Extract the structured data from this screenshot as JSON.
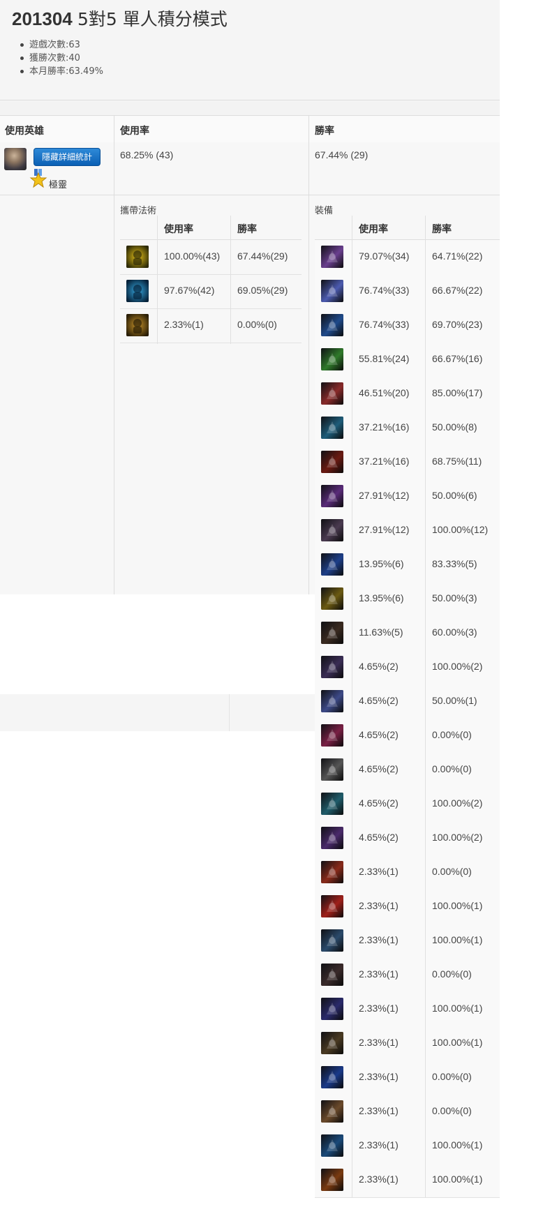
{
  "page": {
    "title_number": "201304",
    "title_mode": "5對5 單人積分模式",
    "stats": [
      "遊戲次數:63",
      "獲勝次數:40",
      "本月勝率:63.49%"
    ]
  },
  "main_table": {
    "headers": [
      "使用英雄",
      "使用率",
      "勝率"
    ],
    "hide_button": "隱藏詳細統計",
    "rank_label": "極靈",
    "usage": "68.25%  (43)",
    "winrate": "67.44%  (29)"
  },
  "spells": {
    "title": "攜帶法術",
    "headers": [
      "使用率",
      "勝率"
    ],
    "rows": [
      {
        "icon": "ghost-spell-icon",
        "usage": "100.00%(43)",
        "win": "67.44%(29)"
      },
      {
        "icon": "flash-spell-icon",
        "usage": "97.67%(42)",
        "win": "69.05%(29)"
      },
      {
        "icon": "clarity-spell-icon",
        "usage": "2.33%(1)",
        "win": "0.00%(0)"
      }
    ]
  },
  "items": {
    "title": "裝備",
    "headers": [
      "使用率",
      "勝率"
    ],
    "rows": [
      {
        "icon": "eye-item-icon",
        "color": "#6a3f8f",
        "usage": "79.07%(34)",
        "win": "64.71%(22)"
      },
      {
        "icon": "orb-item-icon",
        "color": "#4c5bb0",
        "usage": "76.74%(33)",
        "win": "66.67%(22)"
      },
      {
        "icon": "boots-item-icon",
        "color": "#1f4b8c",
        "usage": "76.74%(33)",
        "win": "69.70%(23)"
      },
      {
        "icon": "ward-item-icon",
        "color": "#2f7a2a",
        "usage": "55.81%(24)",
        "win": "66.67%(16)"
      },
      {
        "icon": "sorcerer-boots-icon",
        "color": "#8a2a2a",
        "usage": "46.51%(20)",
        "win": "85.00%(17)"
      },
      {
        "icon": "boots-enchant-icon",
        "color": "#1e5d7a",
        "usage": "37.21%(16)",
        "win": "50.00%(8)"
      },
      {
        "icon": "ruby-item-icon",
        "color": "#6b1a12",
        "usage": "37.21%(16)",
        "win": "68.75%(11)"
      },
      {
        "icon": "tome-item-icon",
        "color": "#5a2b7a",
        "usage": "27.91%(12)",
        "win": "50.00%(6)"
      },
      {
        "icon": "blade-item-icon",
        "color": "#4a3a50",
        "usage": "27.91%(12)",
        "win": "100.00%(12)"
      },
      {
        "icon": "chalice-item-icon",
        "color": "#1d3f8a",
        "usage": "13.95%(6)",
        "win": "83.33%(5)"
      },
      {
        "icon": "staff-item-icon",
        "color": "#6b5a12",
        "usage": "13.95%(6)",
        "win": "50.00%(3)"
      },
      {
        "icon": "cloak-item-icon",
        "color": "#3a2a20",
        "usage": "11.63%(5)",
        "win": "60.00%(3)"
      },
      {
        "icon": "wand-item-icon",
        "color": "#3a2d55",
        "usage": "4.65%(2)",
        "win": "100.00%(2)"
      },
      {
        "icon": "dagger-item-icon",
        "color": "#3d4a88",
        "usage": "4.65%(2)",
        "win": "50.00%(1)"
      },
      {
        "icon": "pink-eye-icon",
        "color": "#7a1f45",
        "usage": "4.65%(2)",
        "win": "0.00%(0)"
      },
      {
        "icon": "armor-item-icon",
        "color": "#555555",
        "usage": "4.65%(2)",
        "win": "0.00%(0)"
      },
      {
        "icon": "seer-stone-icon",
        "color": "#1f5d6b",
        "usage": "4.65%(2)",
        "win": "100.00%(2)"
      },
      {
        "icon": "spear-item-icon",
        "color": "#4a2a6b",
        "usage": "4.65%(2)",
        "win": "100.00%(2)"
      },
      {
        "icon": "potion-item-icon",
        "color": "#8a2a1a",
        "usage": "2.33%(1)",
        "win": "0.00%(0)"
      },
      {
        "icon": "ring-item-icon",
        "color": "#a0201a",
        "usage": "2.33%(1)",
        "win": "100.00%(1)"
      },
      {
        "icon": "hammer-item-icon",
        "color": "#2a4a6b",
        "usage": "2.33%(1)",
        "win": "100.00%(1)"
      },
      {
        "icon": "sword-item-icon",
        "color": "#3a2a2a",
        "usage": "2.33%(1)",
        "win": "0.00%(0)"
      },
      {
        "icon": "scepter-item-icon",
        "color": "#2a2a6b",
        "usage": "2.33%(1)",
        "win": "100.00%(1)"
      },
      {
        "icon": "book-item-icon",
        "color": "#4a3a22",
        "usage": "2.33%(1)",
        "win": "100.00%(1)"
      },
      {
        "icon": "droplet-item-icon",
        "color": "#1a3a8a",
        "usage": "2.33%(1)",
        "win": "0.00%(0)"
      },
      {
        "icon": "codex-item-icon",
        "color": "#6b4a2a",
        "usage": "2.33%(1)",
        "win": "0.00%(0)"
      },
      {
        "icon": "shard-item-icon",
        "color": "#1a4a7a",
        "usage": "2.33%(1)",
        "win": "100.00%(1)"
      },
      {
        "icon": "crest-item-icon",
        "color": "#7a3a10",
        "usage": "2.33%(1)",
        "win": "100.00%(1)"
      }
    ]
  }
}
